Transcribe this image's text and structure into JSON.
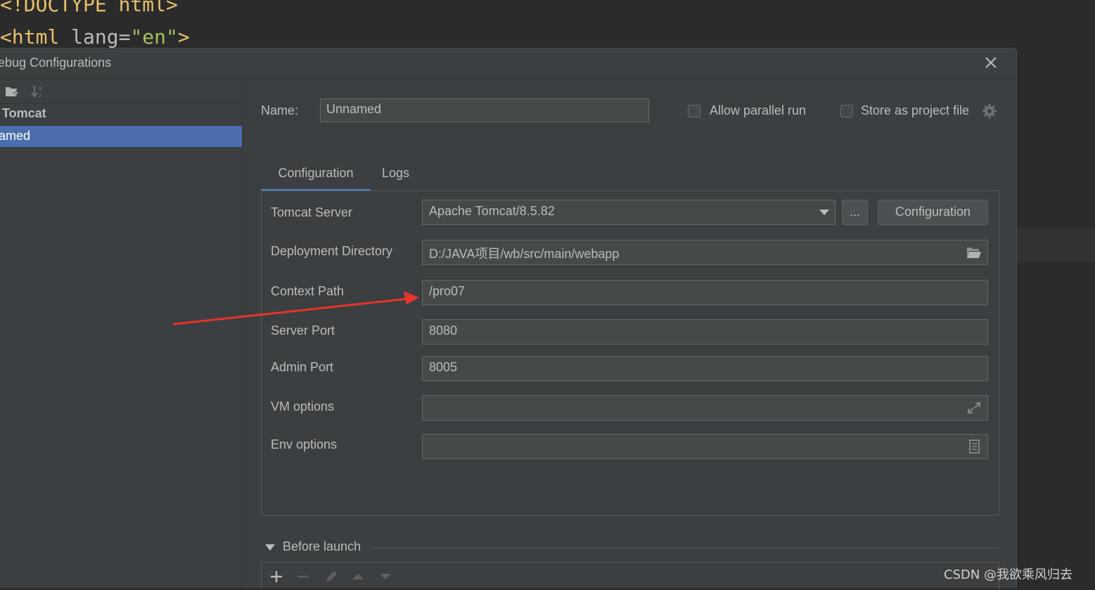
{
  "editor": {
    "line1": "<!DOCTYPE html>",
    "line2": {
      "open": "<html",
      "attr": "lang",
      "eq": "=",
      "value": "\"en\"",
      "close": ">"
    }
  },
  "dialog": {
    "title": "ebug Configurations",
    "close_icon": "close-icon"
  },
  "left_panel": {
    "toolbar": [
      "new-folder-icon",
      "sort-alpha-icon"
    ],
    "group": "Tomcat",
    "selected_item": "amed"
  },
  "right_panel": {
    "name_label": "Name:",
    "name_value": "Unnamed",
    "allow_parallel_label": "Allow parallel run",
    "allow_parallel_checked": false,
    "store_project_label": "Store as project file",
    "store_project_checked": false,
    "tabs": [
      {
        "label": "Configuration",
        "active": true
      },
      {
        "label": "Logs",
        "active": false
      }
    ],
    "config": {
      "tomcat_server_label": "Tomcat Server",
      "tomcat_server_value": "Apache Tomcat/8.5.82",
      "browse_button": "...",
      "configuration_button": "Configuration",
      "deployment_dir_label": "Deployment Directory",
      "deployment_dir_value": "D:/JAVA项目/wb/src/main/webapp",
      "context_path_label": "Context Path",
      "context_path_value": "/pro07",
      "server_port_label": "Server Port",
      "server_port_value": "8080",
      "admin_port_label": "Admin Port",
      "admin_port_value": "8005",
      "vm_options_label": "VM options",
      "vm_options_value": "",
      "env_options_label": "Env options",
      "env_options_value": ""
    },
    "before_launch": {
      "label": "Before launch",
      "tools": [
        "add-icon",
        "remove-icon",
        "edit-icon",
        "move-up-icon",
        "move-down-icon"
      ]
    }
  },
  "watermark": "CSDN @我欲乘风归去",
  "colors": {
    "selection": "#4b6eaf",
    "tab_underline": "#4a88c7",
    "annotation_arrow": "#e8342a"
  }
}
